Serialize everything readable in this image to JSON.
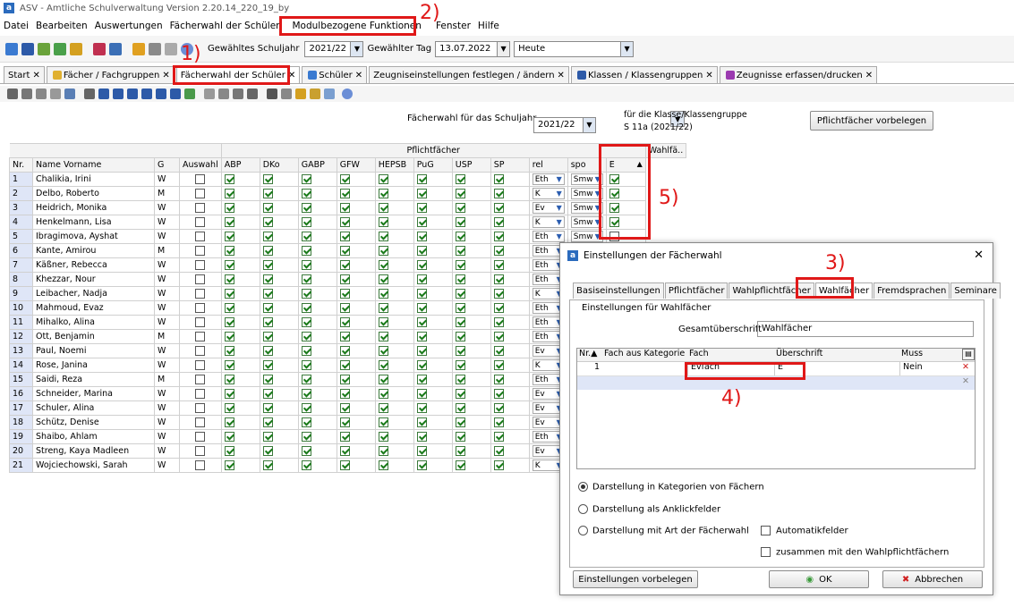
{
  "window": {
    "title": "ASV - Amtliche Schulverwaltung Version 2.20.14_220_19_by"
  },
  "menu": [
    "Datei",
    "Bearbeiten",
    "Auswertungen",
    "Fächerwahl der Schüler",
    "Modulbezogene Funktionen",
    "Fenster",
    "Hilfe"
  ],
  "toolbar": {
    "schuljahr_label": "Gewähltes Schuljahr",
    "schuljahr_value": "2021/22",
    "tag_label": "Gewählter Tag",
    "tag_value": "13.07.2022",
    "heute_value": "Heute"
  },
  "tabs": [
    "Start",
    "Fächer / Fachgruppen",
    "Fächerwahl der Schüler",
    "Schüler",
    "Zeugniseinstellungen festlegen / ändern",
    "Klassen / Klassengruppen",
    "Zeugnisse erfassen/drucken"
  ],
  "selection": {
    "label": "Fächerwahl für das Schuljahr",
    "value": "2021/22",
    "klasse_label": "für die Klasse/Klassengruppe",
    "klasse_value": "S 11a (2021/22)",
    "button": "Pflichtfächer vorbelegen"
  },
  "grid": {
    "group_pflicht": "Pflichtfächer",
    "group_wahl": "Wahlfä..",
    "headers": [
      "Nr.",
      "Name Vorname",
      "G",
      "Auswahl",
      "ABP",
      "DKo",
      "GABP",
      "GFW",
      "HEPSB",
      "PuG",
      "USP",
      "SP",
      "rel",
      "spo",
      "E"
    ],
    "rows": [
      {
        "nr": "1",
        "name": "Chalikia, Irini",
        "g": "W",
        "rel": "Eth",
        "spo": "Smw",
        "e": true
      },
      {
        "nr": "2",
        "name": "Delbo, Roberto",
        "g": "M",
        "rel": "K",
        "spo": "Smw",
        "e": true
      },
      {
        "nr": "3",
        "name": "Heidrich, Monika",
        "g": "W",
        "rel": "Ev",
        "spo": "Smw",
        "e": true
      },
      {
        "nr": "4",
        "name": "Henkelmann, Lisa",
        "g": "W",
        "rel": "K",
        "spo": "Smw",
        "e": true
      },
      {
        "nr": "5",
        "name": "Ibragimova, Ayshat",
        "g": "W",
        "rel": "Eth",
        "spo": "Smw",
        "e": false
      },
      {
        "nr": "6",
        "name": "Kante, Amirou",
        "g": "M",
        "rel": "Eth",
        "spo": "",
        "e": false
      },
      {
        "nr": "7",
        "name": "Käßner, Rebecca",
        "g": "W",
        "rel": "Eth",
        "spo": "",
        "e": false
      },
      {
        "nr": "8",
        "name": "Khezzar, Nour",
        "g": "W",
        "rel": "Eth",
        "spo": "",
        "e": false
      },
      {
        "nr": "9",
        "name": "Leibacher, Nadja",
        "g": "W",
        "rel": "K",
        "spo": "",
        "e": false
      },
      {
        "nr": "10",
        "name": "Mahmoud, Evaz",
        "g": "W",
        "rel": "Eth",
        "spo": "",
        "e": false
      },
      {
        "nr": "11",
        "name": "Mihalko, Alina",
        "g": "W",
        "rel": "Eth",
        "spo": "",
        "e": false
      },
      {
        "nr": "12",
        "name": "Ott, Benjamin",
        "g": "M",
        "rel": "Eth",
        "spo": "",
        "e": false
      },
      {
        "nr": "13",
        "name": "Paul, Noemi",
        "g": "W",
        "rel": "Ev",
        "spo": "",
        "e": false
      },
      {
        "nr": "14",
        "name": "Rose, Janina",
        "g": "W",
        "rel": "K",
        "spo": "",
        "e": false
      },
      {
        "nr": "15",
        "name": "Saidi, Reza",
        "g": "M",
        "rel": "Eth",
        "spo": "",
        "e": false
      },
      {
        "nr": "16",
        "name": "Schneider, Marina",
        "g": "W",
        "rel": "Ev",
        "spo": "",
        "e": false
      },
      {
        "nr": "17",
        "name": "Schuler, Alina",
        "g": "W",
        "rel": "Ev",
        "spo": "",
        "e": false
      },
      {
        "nr": "18",
        "name": "Schütz, Denise",
        "g": "W",
        "rel": "Ev",
        "spo": "",
        "e": false
      },
      {
        "nr": "19",
        "name": "Shaibo, Ahlam",
        "g": "W",
        "rel": "Eth",
        "spo": "",
        "e": false
      },
      {
        "nr": "20",
        "name": "Streng, Kaya Madleen",
        "g": "W",
        "rel": "Ev",
        "spo": "",
        "e": false
      },
      {
        "nr": "21",
        "name": "Wojciechowski, Sarah",
        "g": "W",
        "rel": "K",
        "spo": "",
        "e": false
      }
    ]
  },
  "dialog": {
    "title": "Einstellungen der Fächerwahl",
    "tabs": [
      "Basiseinstellungen",
      "Pflichtfächer",
      "Wahlpflichtfächer",
      "Wahlfächer",
      "Fremdsprachen",
      "Seminare"
    ],
    "section": "Einstellungen für Wahlfächer",
    "gesamt_label": "Gesamtüberschrift",
    "gesamt_value": "Wahlfächer",
    "table_headers": [
      "Nr.",
      "Fach aus Kategorie",
      "Fach",
      "Überschrift",
      "Muss"
    ],
    "row": {
      "nr": "1",
      "kat": "",
      "fach": "Evfach",
      "ueberschrift": "E",
      "muss": "Nein"
    },
    "radios": [
      "Darstellung in Kategorien von Fächern",
      "Darstellung als Anklickfelder",
      "Darstellung mit Art der Fächerwahl"
    ],
    "checks": [
      "Automatikfelder",
      "zusammen mit den Wahlpflichtfächern"
    ],
    "buttons": {
      "vorbelegen": "Einstellungen vorbelegen",
      "ok": "OK",
      "abbrechen": "Abbrechen"
    }
  },
  "annotations": [
    "1)",
    "2)",
    "3)",
    "4)",
    "5)"
  ]
}
